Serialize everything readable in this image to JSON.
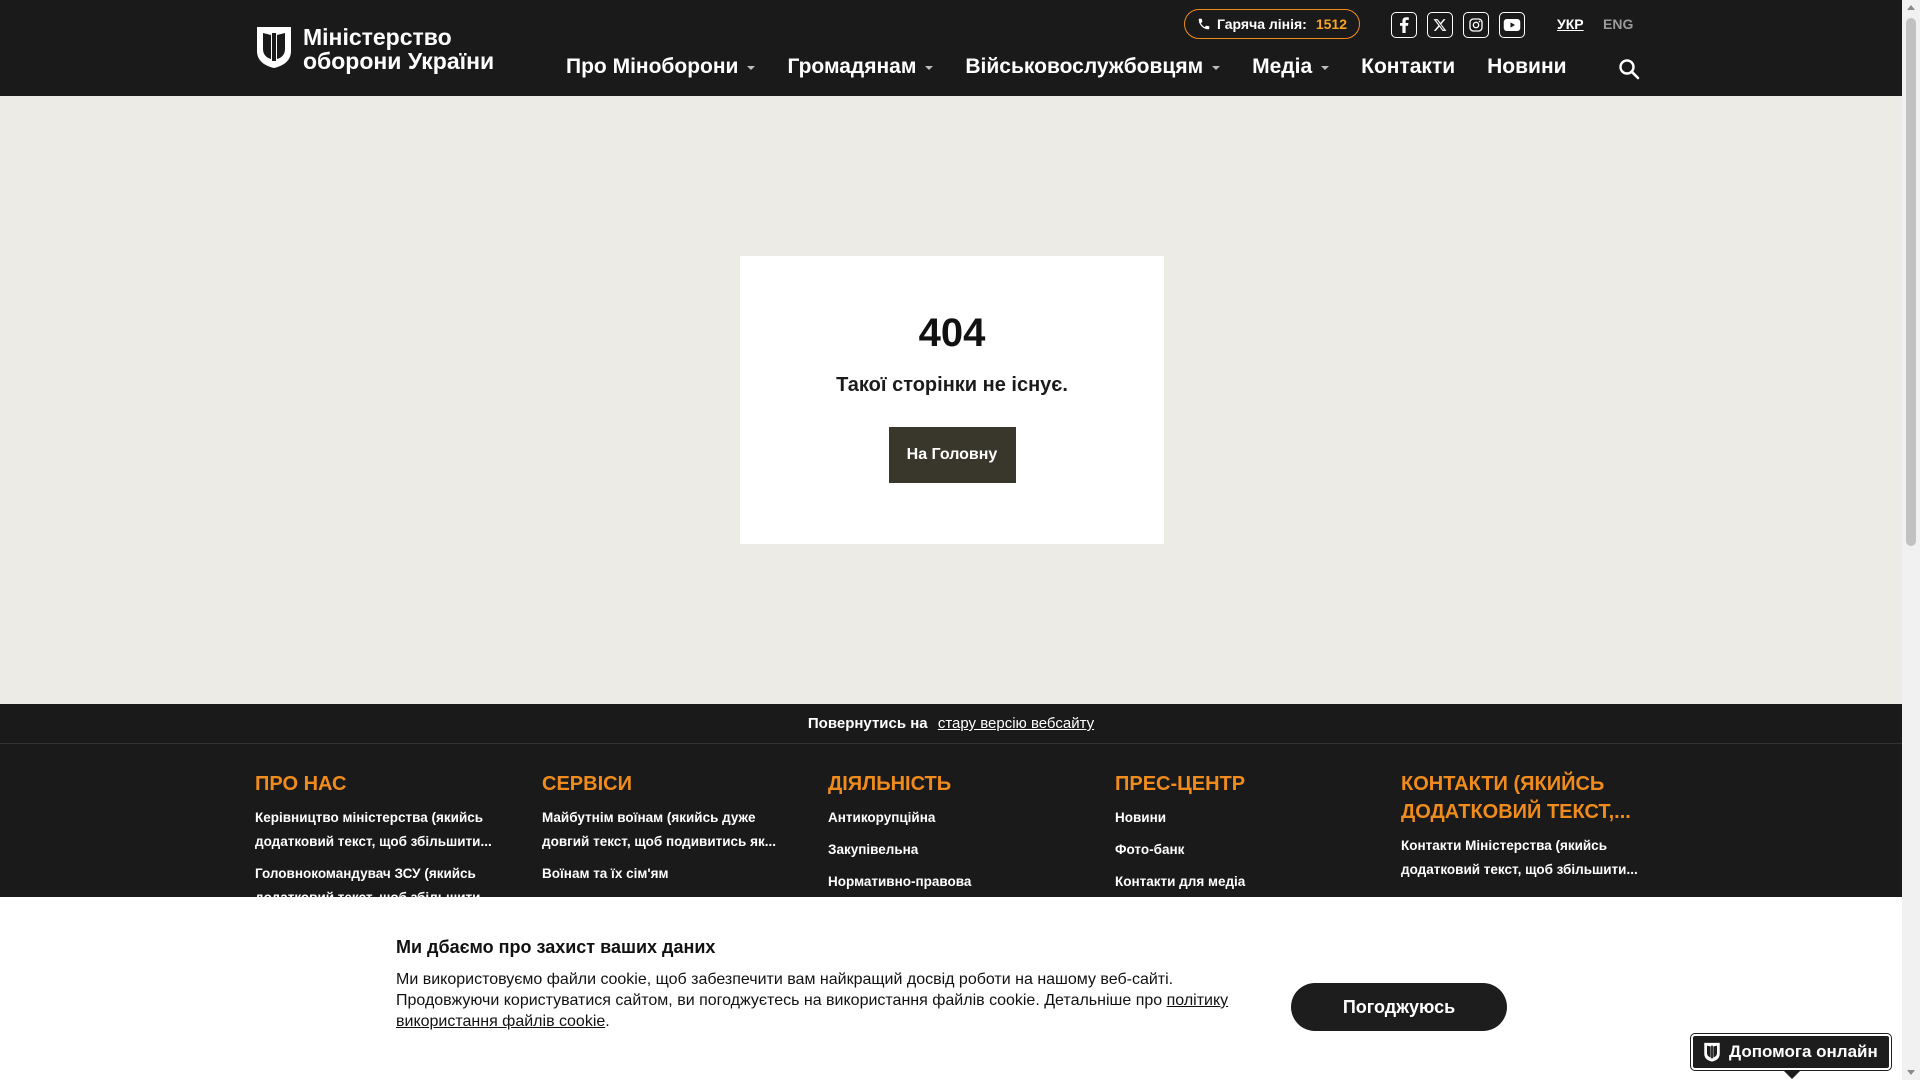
{
  "header": {
    "logo_line1": "Міністерство",
    "logo_line2": "оборони України",
    "hotline_label": "Гаряча лінія:",
    "hotline_number": "1512",
    "social": [
      "f",
      "X",
      "ig",
      "yt"
    ],
    "lang_active": "УКР",
    "lang_other": "ENG",
    "nav": [
      {
        "label": "Про Міноборони",
        "dropdown": true
      },
      {
        "label": "Громадянам",
        "dropdown": true
      },
      {
        "label": "Військовослужбовцям",
        "dropdown": true
      },
      {
        "label": "Медіа",
        "dropdown": true
      },
      {
        "label": "Контакти",
        "dropdown": false
      },
      {
        "label": "Новини",
        "dropdown": false
      }
    ]
  },
  "error": {
    "code": "404",
    "message": "Такої сторінки не існує.",
    "button": "На Головну"
  },
  "footer": {
    "old_site_prefix": "Повернутись на",
    "old_site_link": "стару версію вебсайту",
    "columns": [
      {
        "title": "ПРО НАС",
        "links": [
          "Керівництво міністерства (якийсь додатковий текст, щоб збільшити...",
          "Головнокомандувач ЗСУ (якийсь додатковий текст, щоб збільшити..."
        ]
      },
      {
        "title": "СЕРВІСИ",
        "links": [
          "Майбутнім воїнам (якийсь дуже довгий текст, щоб подивитись як...",
          "Воїнам та їх сім'ям"
        ]
      },
      {
        "title": "ДІЯЛЬНІСТЬ",
        "links": [
          "Антикорупційна",
          "Закупівельна",
          "Нормативно-правова"
        ]
      },
      {
        "title": "ПРЕС-ЦЕНТР",
        "links": [
          "Новини",
          "Фото-банк",
          "Контакти для медіа"
        ]
      },
      {
        "title": "КОНТАКТИ (ЯКИЙСЬ ДОДАТКОВИЙ ТЕКСТ,...",
        "links": [
          "Контакти Міністерства (якийсь додатковий текст, щоб збільшити..."
        ]
      }
    ]
  },
  "cookie": {
    "title": "Ми дбаємо про захист ваших даних",
    "text": "Ми використовуємо файли cookie, щоб забезпечити вам найкращий досвід роботи на нашому веб-сайті. Продовжуючи користуватися сайтом, ви погоджуєтесь на використання файлів cookie. Детальніше про",
    "policy_link": "політику використання файлів cookie",
    "text_end": ".",
    "agree_button": "Погоджуюсь"
  },
  "help": {
    "label": "Допомога онлайн"
  },
  "colors": {
    "header_bg": "#1a1a1a",
    "accent_orange": "#f08c1c",
    "page_bg": "#edebe6",
    "button_dark": "#39362b"
  }
}
